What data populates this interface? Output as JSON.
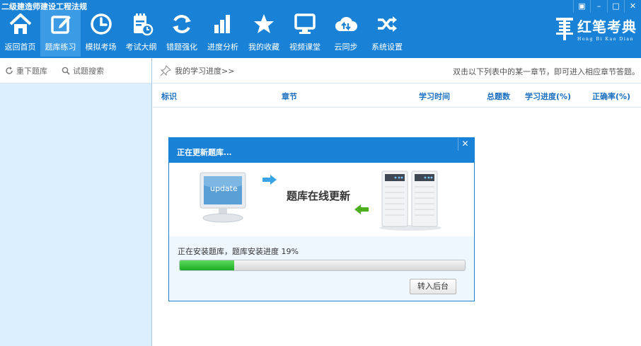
{
  "window": {
    "title": "二级建造师建设工程法规",
    "controls": [
      "▣",
      "–",
      "□",
      "✕"
    ]
  },
  "nav": {
    "items": [
      {
        "label": "返回首页",
        "icon": "home-icon"
      },
      {
        "label": "题库练习",
        "icon": "edit-icon",
        "active": true
      },
      {
        "label": "模拟考场",
        "icon": "clock-icon"
      },
      {
        "label": "考试大纲",
        "icon": "syllabus-icon"
      },
      {
        "label": "错题强化",
        "icon": "refresh-icon"
      },
      {
        "label": "进度分析",
        "icon": "bar-chart-icon"
      },
      {
        "label": "我的收藏",
        "icon": "star-icon"
      },
      {
        "label": "视频课堂",
        "icon": "monitor-icon"
      },
      {
        "label": "云同步",
        "icon": "cloud-sync-icon"
      },
      {
        "label": "系统设置",
        "icon": "shuffle-icon"
      }
    ]
  },
  "brand": {
    "name_cn": "红笔考典",
    "name_en": "Hong Bi Kao Dian",
    "logo_icon": "pen-logo-icon"
  },
  "sidebar": {
    "tools": [
      {
        "label": "重下题库",
        "icon": "reload-icon"
      },
      {
        "label": "试题搜索",
        "icon": "search-icon"
      }
    ]
  },
  "main": {
    "breadcrumb": "我的学习进度>>",
    "hint": "双击以下列表中的某一章节，即可进入相应章节答题。",
    "columns": [
      "标识",
      "章节",
      "学习时间",
      "总题数",
      "学习进度(%)",
      "正确率(%)"
    ]
  },
  "dialog": {
    "title": "正在更新题库...",
    "close_label": "✕",
    "monitor_text": "update",
    "caption": "题库在线更新",
    "status": "正在安装题库，题库安装进度 19%",
    "progress": 19,
    "background_button": "转入后台"
  },
  "colors": {
    "accent": "#1a82d6",
    "active_tab": "#3b9be5",
    "sidebar_bg": "#dbefff",
    "progress_green": "#1cab25",
    "arrow_blue": "#3aa3e6",
    "arrow_green": "#4caf1e"
  }
}
